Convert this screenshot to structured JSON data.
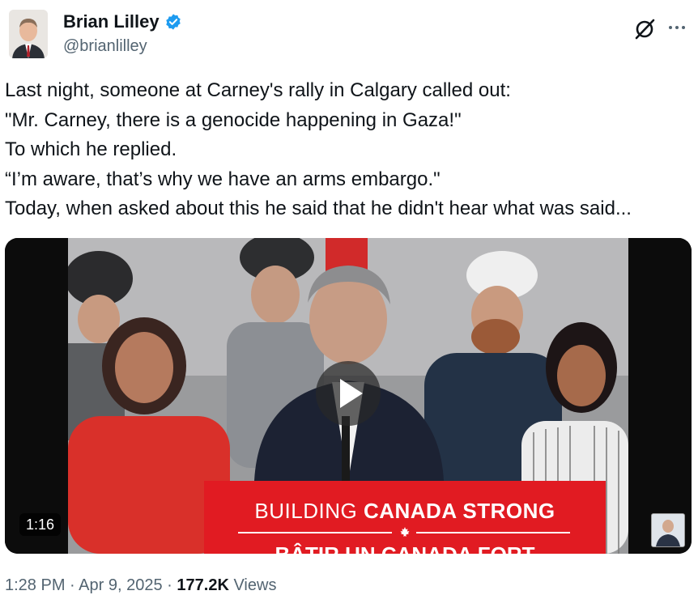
{
  "author": {
    "display_name": "Brian Lilley",
    "handle": "@brianlilley",
    "verified": true
  },
  "icons": {
    "verified": "verified-badge-icon",
    "grok": "grok-icon",
    "more": "more-options-icon",
    "play": "play-icon"
  },
  "tweet": {
    "text": "Last night, someone at Carney's rally in Calgary called out:\n\"Mr. Carney, there is a genocide happening in Gaza!\"\nTo which he replied.\n“I’m aware, that’s why we have an arms embargo.\"\nToday, when asked about this he said that he didn't hear what was said..."
  },
  "media": {
    "duration": "1:16",
    "sign_line1_regular": "BUILDING",
    "sign_line1_bold": "CANADA STRONG",
    "sign_line2": "BÂTIR UN CANADA FORT"
  },
  "meta": {
    "time": "1:28 PM",
    "separator": "·",
    "date": "Apr 9, 2025",
    "views_count": "177.2K",
    "views_label": "Views"
  },
  "colors": {
    "text_primary": "#0f1419",
    "text_secondary": "#536471",
    "verified_blue": "#1d9bf0",
    "sign_red": "#e11b22"
  }
}
